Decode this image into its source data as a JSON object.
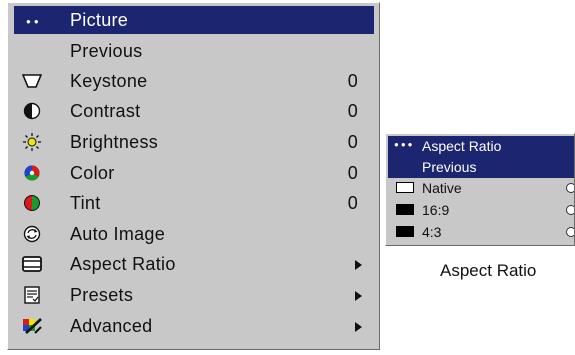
{
  "menu": {
    "items": [
      {
        "label": "Picture",
        "icon": "dots-icon",
        "value": "",
        "submenu": false,
        "selected": true
      },
      {
        "label": "Previous",
        "icon": "",
        "value": "",
        "submenu": false,
        "selected": false
      },
      {
        "label": "Keystone",
        "icon": "keystone-icon",
        "value": "0",
        "submenu": false,
        "selected": false
      },
      {
        "label": "Contrast",
        "icon": "contrast-icon",
        "value": "0",
        "submenu": false,
        "selected": false
      },
      {
        "label": "Brightness",
        "icon": "brightness-icon",
        "value": "0",
        "submenu": false,
        "selected": false
      },
      {
        "label": "Color",
        "icon": "color-icon",
        "value": "0",
        "submenu": false,
        "selected": false
      },
      {
        "label": "Tint",
        "icon": "tint-icon",
        "value": "0",
        "submenu": false,
        "selected": false
      },
      {
        "label": "Auto Image",
        "icon": "auto-image-icon",
        "value": "",
        "submenu": false,
        "selected": false
      },
      {
        "label": "Aspect Ratio",
        "icon": "aspect-ratio-icon",
        "value": "",
        "submenu": true,
        "selected": false
      },
      {
        "label": "Presets",
        "icon": "presets-icon",
        "value": "",
        "submenu": true,
        "selected": false
      },
      {
        "label": "Advanced",
        "icon": "advanced-icon",
        "value": "",
        "submenu": true,
        "selected": false
      }
    ]
  },
  "submenu": {
    "title": "Aspect Ratio",
    "previous": "Previous",
    "options": [
      {
        "label": "Native",
        "swatch": "#ffffff"
      },
      {
        "label": "16:9",
        "swatch": "#000000"
      },
      {
        "label": "4:3",
        "swatch": "#000000"
      }
    ]
  },
  "caption": "Aspect Ratio",
  "colors": {
    "highlight": "#1c2670",
    "panel": "#c8c8c8"
  }
}
